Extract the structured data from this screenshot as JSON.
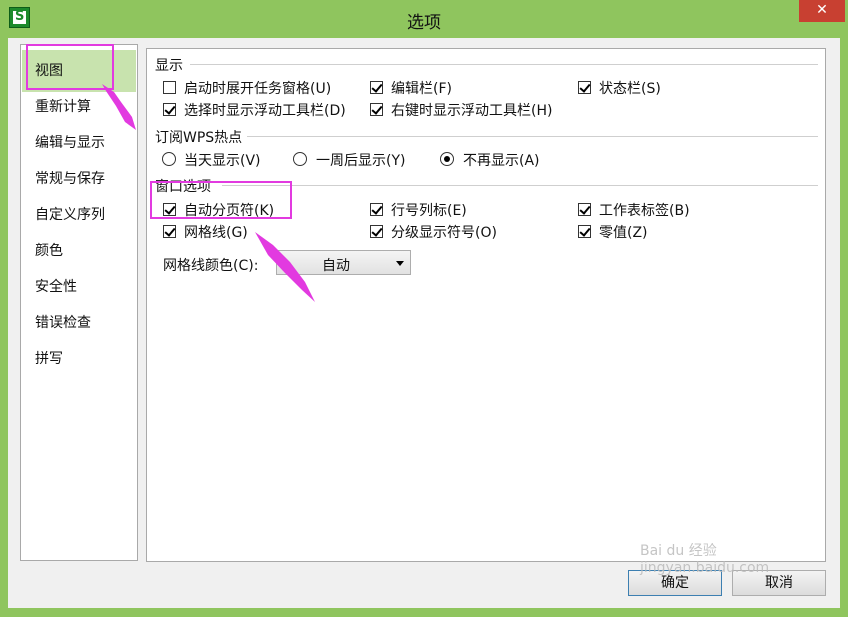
{
  "window": {
    "title": "选项",
    "close_glyph": "✕"
  },
  "nav": {
    "items": [
      "视图",
      "重新计算",
      "编辑与显示",
      "常规与保存",
      "自定义序列",
      "颜色",
      "安全性",
      "错误检查",
      "拼写"
    ],
    "selected": "视图"
  },
  "display": {
    "label": "显示",
    "options": [
      {
        "label": "启动时展开任务窗格(U)",
        "checked": false
      },
      {
        "label": "编辑栏(F)",
        "checked": true
      },
      {
        "label": "状态栏(S)",
        "checked": true
      },
      {
        "label": "选择时显示浮动工具栏(D)",
        "checked": true
      },
      {
        "label": "右键时显示浮动工具栏(H)",
        "checked": true
      }
    ]
  },
  "hotspot": {
    "label": "订阅WPS热点",
    "options": [
      {
        "label": "当天显示(V)",
        "selected": false
      },
      {
        "label": "一周后显示(Y)",
        "selected": false
      },
      {
        "label": "不再显示(A)",
        "selected": true
      }
    ]
  },
  "window_options": {
    "label": "窗口选项",
    "options": [
      {
        "label": "自动分页符(K)",
        "checked": true
      },
      {
        "label": "行号列标(E)",
        "checked": true
      },
      {
        "label": "工作表标签(B)",
        "checked": true
      },
      {
        "label": "网格线(G)",
        "checked": true
      },
      {
        "label": "分级显示符号(O)",
        "checked": true
      },
      {
        "label": "零值(Z)",
        "checked": true
      }
    ],
    "gridline_color_label": "网格线颜色(C):",
    "gridline_color_value": "自动"
  },
  "buttons": {
    "ok": "确定",
    "cancel": "取消"
  },
  "watermark": "Bai du 经验 jingyan.baidu.com",
  "colors": {
    "titlebar": "#8fc55e",
    "highlight": "#e23ae0",
    "nav_selected": "#c8e3ae"
  }
}
